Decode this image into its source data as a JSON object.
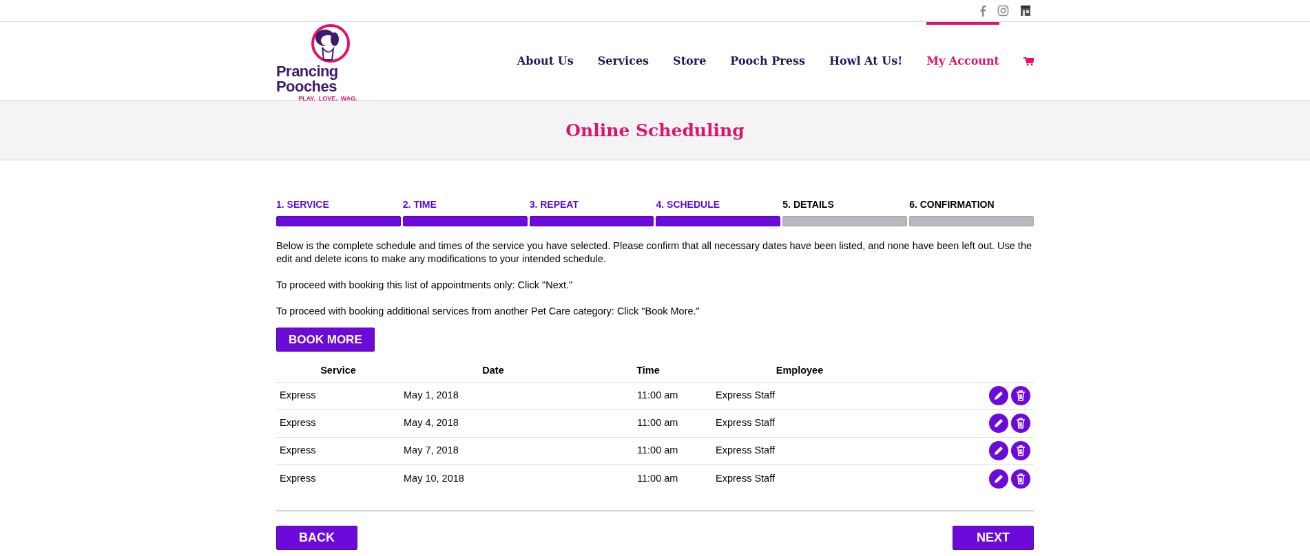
{
  "logo": {
    "name": "Prancing Pooches",
    "tagline": "PLAY.  LOVE.  WAG."
  },
  "nav": [
    {
      "label": "About Us",
      "selected": false
    },
    {
      "label": "Services",
      "selected": false
    },
    {
      "label": "Store",
      "selected": false
    },
    {
      "label": "Pooch Press",
      "selected": false
    },
    {
      "label": "Howl At Us!",
      "selected": false
    },
    {
      "label": "My Account",
      "selected": true
    }
  ],
  "page_title": "Online Scheduling",
  "steps": [
    {
      "label": "1. SERVICE",
      "completed": true
    },
    {
      "label": "2. TIME",
      "completed": true
    },
    {
      "label": "3. REPEAT",
      "completed": true
    },
    {
      "label": "4. SCHEDULE",
      "completed": true
    },
    {
      "label": "5. DETAILS",
      "completed": false
    },
    {
      "label": "6. CONFIRMATION",
      "completed": false
    }
  ],
  "paragraphs": [
    "Below is the complete schedule and times of the service you have selected. Please confirm that all necessary dates have been listed, and none have been left out. Use the edit and delete icons to make any modifications to your intended schedule.",
    "To proceed with booking this list of appointments only: Click \"Next.\"",
    "To proceed with booking additional services from another Pet Care category: Click \"Book More.\""
  ],
  "book_more_button": "BOOK MORE",
  "table": {
    "columns": [
      "Service",
      "Date",
      "Time",
      "Employee"
    ],
    "rows": [
      [
        "Express",
        "May 1, 2018",
        "11:00 am",
        "Express Staff"
      ],
      [
        "Express",
        "May 4, 2018",
        "11:00 am",
        "Express Staff"
      ],
      [
        "Express",
        "May 7, 2018",
        "11:00 am",
        "Express Staff"
      ],
      [
        "Express",
        "May 10, 2018",
        "11:00 am",
        "Express Staff"
      ]
    ]
  },
  "back_button": "BACK",
  "next_button": "NEXT"
}
